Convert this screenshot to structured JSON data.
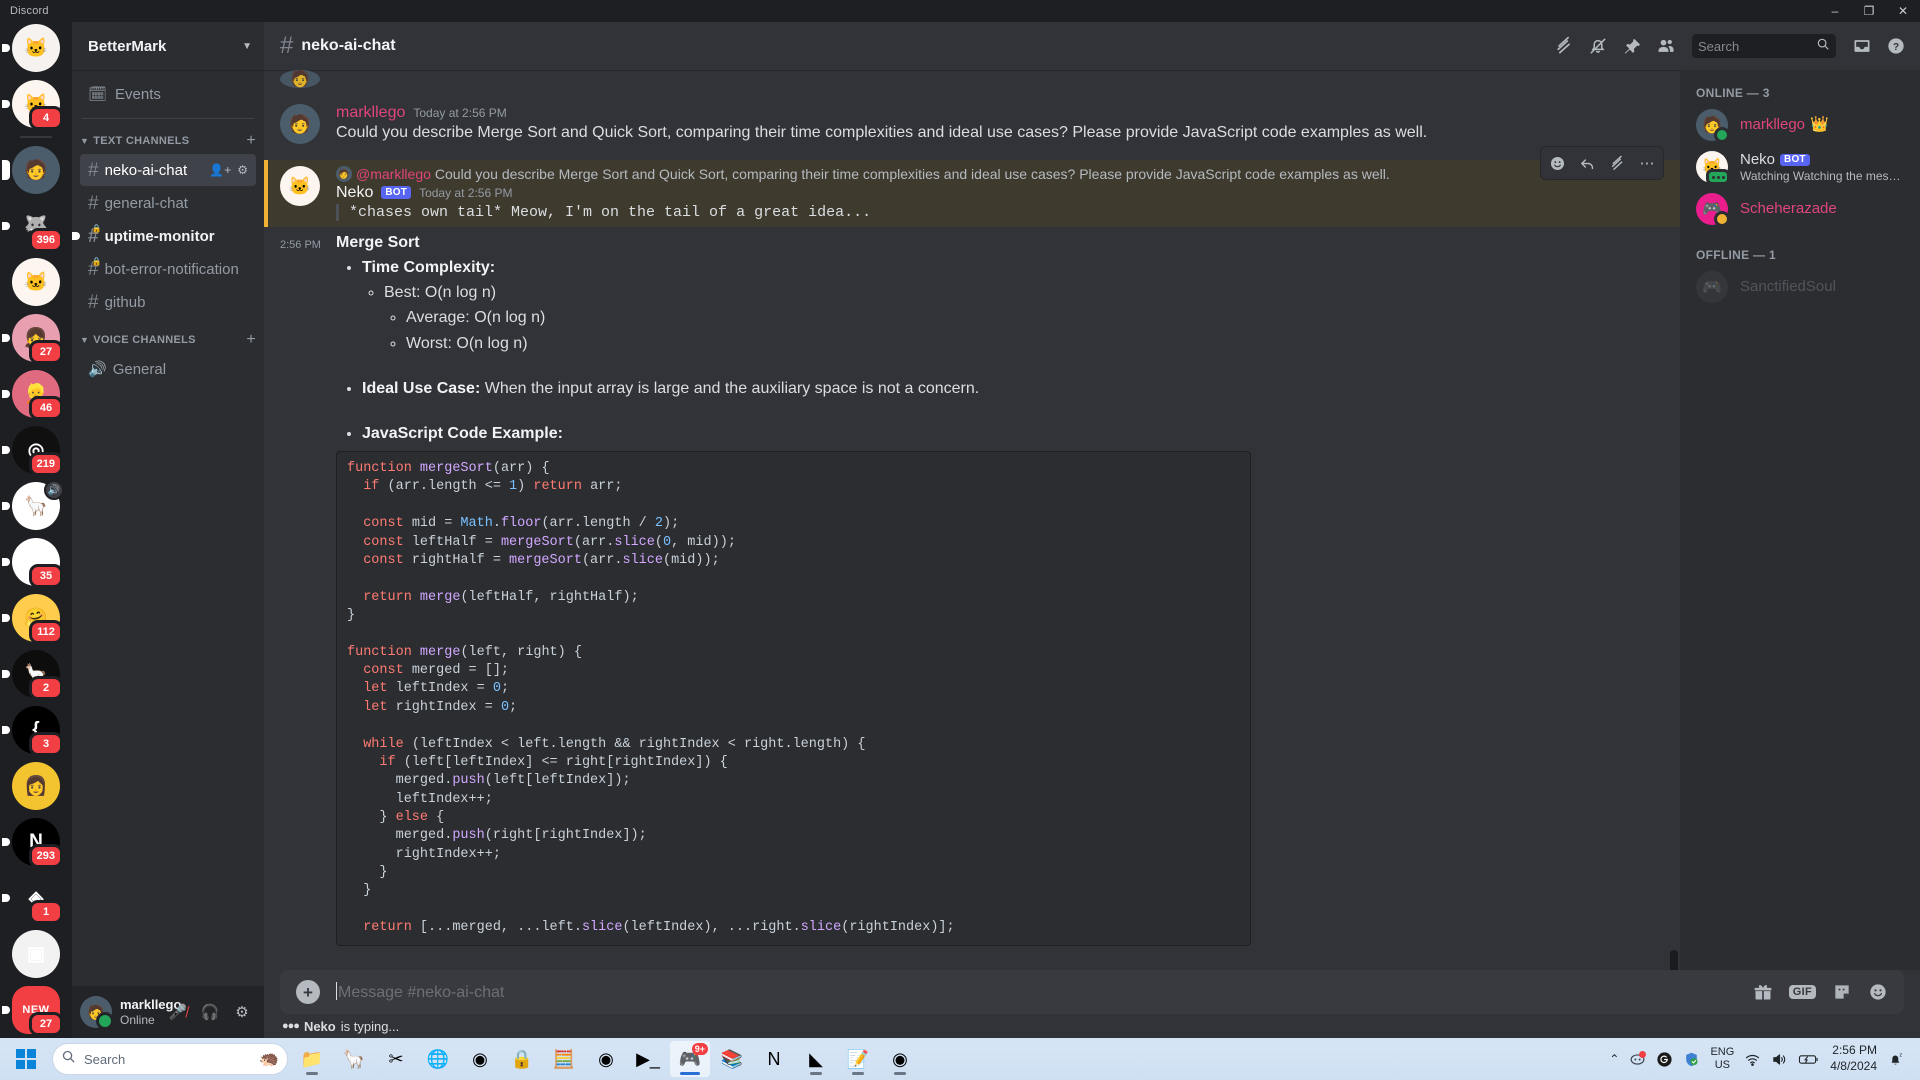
{
  "window": {
    "title": "Discord",
    "minimize": "–",
    "maximize": "❐",
    "close": "✕"
  },
  "rail": {
    "servers": [
      {
        "name": "neko-server-top",
        "badge": "",
        "glyph": "🐱",
        "bg": "#f6f2ef",
        "pill": "dot"
      },
      {
        "name": "meow-server",
        "badge": "4",
        "glyph": "🐱",
        "bg": "#fdf6f0",
        "pill": "dot"
      },
      {
        "name": "bettermark-server",
        "badge": "",
        "glyph": "🧑",
        "bg": "#4b5d6b",
        "pill": "tall"
      },
      {
        "name": "inu-server",
        "badge": "396",
        "glyph": "🐺",
        "bg": "#1e1f22",
        "pill": "dot"
      },
      {
        "name": "meow-server-2",
        "badge": "",
        "glyph": "🐱",
        "bg": "#fdf6f0",
        "pill": ""
      },
      {
        "name": "anime-server-1",
        "badge": "27",
        "glyph": "👧",
        "bg": "#e8a0b0",
        "pill": "dot"
      },
      {
        "name": "anime-server-2",
        "badge": "46",
        "glyph": "👱",
        "bg": "#e06a80",
        "pill": "dot"
      },
      {
        "name": "openai-server",
        "badge": "219",
        "glyph": "◎",
        "bg": "#101010",
        "pill": "dot"
      },
      {
        "name": "llama-server",
        "badge": "",
        "glyph": "🦙",
        "bg": "#ffffff",
        "pill": "dot",
        "voice": "🔊"
      },
      {
        "name": "drive-server",
        "badge": "35",
        "glyph": "◆",
        "bg": "#ffffff",
        "pill": "dot"
      },
      {
        "name": "emoji-server",
        "badge": "112",
        "glyph": "🤗",
        "bg": "#ffcc4d",
        "pill": "dot"
      },
      {
        "name": "ollama-server",
        "badge": "2",
        "glyph": "🦙",
        "bg": "#0d0d0d",
        "pill": "dot"
      },
      {
        "name": "brace-server",
        "badge": "3",
        "glyph": "{",
        "bg": "#000000",
        "pill": "dot"
      },
      {
        "name": "kafka-services-server",
        "badge": "",
        "glyph": "👩",
        "bg": "#f4c430",
        "pill": ""
      },
      {
        "name": "notion-dev-server",
        "badge": "293",
        "glyph": "N",
        "bg": "#000000",
        "pill": "dot"
      },
      {
        "name": "orange-diamond-server",
        "badge": "1",
        "glyph": "◈",
        "bg": "#1e1f22",
        "pill": "dot"
      },
      {
        "name": "screenshot-server",
        "badge": "",
        "glyph": "▣",
        "bg": "#f2f2f2",
        "pill": ""
      },
      {
        "name": "new-server",
        "badge": "27",
        "glyph": "",
        "bg": "#f23f43",
        "pill": "dot",
        "banner": "NEW"
      }
    ]
  },
  "sidebar": {
    "guild_name": "BetterMark",
    "events_label": "Events",
    "categories": [
      {
        "name": "TEXT CHANNELS",
        "channels": [
          {
            "name": "neko-ai-chat",
            "state": "active",
            "private": false,
            "actions": [
              "invite",
              "settings"
            ]
          },
          {
            "name": "general-chat",
            "state": "normal",
            "private": false
          },
          {
            "name": "uptime-monitor",
            "state": "unread",
            "private": true
          },
          {
            "name": "bot-error-notification",
            "state": "normal",
            "private": true
          },
          {
            "name": "github",
            "state": "normal",
            "private": false
          }
        ]
      },
      {
        "name": "VOICE CHANNELS",
        "channels": [
          {
            "name": "General",
            "state": "normal",
            "voice": true
          }
        ]
      }
    ],
    "user": {
      "name": "markllego",
      "status": "Online",
      "mic_label": "mute",
      "headset_label": "deafen",
      "settings_label": "settings"
    }
  },
  "header": {
    "channel": "neko-ai-chat",
    "search_placeholder": "Search",
    "icons": [
      "threads-icon",
      "notifications-muted-icon",
      "pinned-messages-icon",
      "members-icon",
      "inbox-icon",
      "help-icon"
    ]
  },
  "messages": {
    "user_message": {
      "author": "markllego",
      "timestamp": "Today at 2:56 PM",
      "text": "Could you describe Merge Sort and Quick Sort, comparing their time complexities and ideal use cases? Please provide JavaScript code examples as well."
    },
    "bot_message": {
      "reply_mention": "@markllego",
      "reply_preview": "Could you describe Merge Sort and Quick Sort, comparing their time complexities and ideal use cases? Please provide JavaScript code examples as well.",
      "author": "Neko",
      "bot_tag": "BOT",
      "timestamp": "Today at 2:56 PM",
      "thinking_line": "*chases own tail* Meow, I'm on the tail of a great idea...",
      "hover_actions": [
        "add-reaction",
        "reply",
        "create-thread",
        "more"
      ]
    },
    "answer": {
      "timestamp": "2:56 PM",
      "heading": "Merge Sort",
      "time_complexity_label": "Time Complexity:",
      "complexities": [
        "Best: O(n log n)",
        "Average: O(n log n)",
        "Worst: O(n log n)"
      ],
      "ideal_label": "Ideal Use Case:",
      "ideal_text": " When the input array is large and the auxiliary space is not a concern.",
      "code_label": "JavaScript Code Example:"
    }
  },
  "composer": {
    "placeholder": "Message #neko-ai-chat",
    "typing_indicator_name": "Neko",
    "typing_indicator_rest": " is typing...",
    "icons": [
      "gift-icon",
      "gif-icon",
      "sticker-icon",
      "emoji-icon"
    ],
    "gif_label": "GIF"
  },
  "members": {
    "online_label": "ONLINE — 3",
    "offline_label": "OFFLINE — 1",
    "online": [
      {
        "name": "markllego",
        "color": "pink",
        "crown": "👑",
        "status": "online",
        "activity": ""
      },
      {
        "name": "Neko",
        "color": "white",
        "bot_tag": "BOT",
        "status": "bot",
        "activity": "Watching Watching the mesm…"
      },
      {
        "name": "Scheherazade",
        "color": "pink",
        "status": "idle",
        "activity": ""
      }
    ],
    "offline": [
      {
        "name": "SanctifiedSoul",
        "color": "off",
        "status": "offline",
        "activity": ""
      }
    ]
  },
  "taskbar": {
    "search_placeholder": "Search",
    "apps": [
      {
        "name": "file-explorer-icon",
        "glyph": "📁",
        "open": true
      },
      {
        "name": "llama-icon",
        "glyph": "🦙",
        "open": false
      },
      {
        "name": "snipping-tool-icon",
        "glyph": "✂",
        "open": false
      },
      {
        "name": "green-globe-icon",
        "glyph": "🌐",
        "open": false
      },
      {
        "name": "github-icon",
        "glyph": "◉",
        "open": false
      },
      {
        "name": "lock-upload-icon",
        "glyph": "🔒",
        "open": false
      },
      {
        "name": "calculator-icon",
        "glyph": "🧮",
        "open": false
      },
      {
        "name": "webcam-icon",
        "glyph": "◉",
        "open": false
      },
      {
        "name": "terminal-icon",
        "glyph": "▶_",
        "open": false
      },
      {
        "name": "discord-icon",
        "glyph": "🎮",
        "open": true,
        "active": true,
        "badge": "9+"
      },
      {
        "name": "notes-app-icon",
        "glyph": "📚",
        "open": false
      },
      {
        "name": "notion-icon",
        "glyph": "N",
        "open": false
      },
      {
        "name": "vscode-icon",
        "glyph": "◣",
        "open": true
      },
      {
        "name": "notepad-icon",
        "glyph": "📝",
        "open": true
      },
      {
        "name": "chrome-icon",
        "glyph": "◉",
        "open": true
      }
    ],
    "tray": {
      "chevron": "⌃",
      "discord_tray_icon": "discord-tray-icon",
      "logitech_icon": "logitech-tray-icon",
      "defender_icon": "windows-defender-icon",
      "language": "ENG",
      "region": "US",
      "wifi": "wifi-icon",
      "volume": "volume-icon",
      "battery": "battery-charging-icon",
      "time": "2:56 PM",
      "date": "4/8/2024",
      "notification": "notification-bell-icon"
    }
  },
  "code": {
    "lines": [
      [
        {
          "t": "function ",
          "c": "kw"
        },
        {
          "t": "mergeSort",
          "c": "fn"
        },
        {
          "t": "(arr) {",
          "c": "pl"
        }
      ],
      [
        {
          "t": "  if ",
          "c": "kw"
        },
        {
          "t": "(arr.length <= ",
          "c": "pl"
        },
        {
          "t": "1",
          "c": "num"
        },
        {
          "t": ") ",
          "c": "pl"
        },
        {
          "t": "return ",
          "c": "kw"
        },
        {
          "t": "arr;",
          "c": "pl"
        }
      ],
      [
        {
          "t": "",
          "c": "pl"
        }
      ],
      [
        {
          "t": "  const ",
          "c": "kw"
        },
        {
          "t": "mid = ",
          "c": "pl"
        },
        {
          "t": "Math",
          "c": "cls"
        },
        {
          "t": ".",
          "c": "pl"
        },
        {
          "t": "floor",
          "c": "fn"
        },
        {
          "t": "(arr.length / ",
          "c": "pl"
        },
        {
          "t": "2",
          "c": "num"
        },
        {
          "t": ");",
          "c": "pl"
        }
      ],
      [
        {
          "t": "  const ",
          "c": "kw"
        },
        {
          "t": "leftHalf = ",
          "c": "pl"
        },
        {
          "t": "mergeSort",
          "c": "fn"
        },
        {
          "t": "(arr.",
          "c": "pl"
        },
        {
          "t": "slice",
          "c": "fn"
        },
        {
          "t": "(",
          "c": "pl"
        },
        {
          "t": "0",
          "c": "num"
        },
        {
          "t": ", mid));",
          "c": "pl"
        }
      ],
      [
        {
          "t": "  const ",
          "c": "kw"
        },
        {
          "t": "rightHalf = ",
          "c": "pl"
        },
        {
          "t": "mergeSort",
          "c": "fn"
        },
        {
          "t": "(arr.",
          "c": "pl"
        },
        {
          "t": "slice",
          "c": "fn"
        },
        {
          "t": "(mid));",
          "c": "pl"
        }
      ],
      [
        {
          "t": "",
          "c": "pl"
        }
      ],
      [
        {
          "t": "  return ",
          "c": "kw"
        },
        {
          "t": "merge",
          "c": "fn"
        },
        {
          "t": "(leftHalf, rightHalf);",
          "c": "pl"
        }
      ],
      [
        {
          "t": "}",
          "c": "pl"
        }
      ],
      [
        {
          "t": "",
          "c": "pl"
        }
      ],
      [
        {
          "t": "function ",
          "c": "kw"
        },
        {
          "t": "merge",
          "c": "fn"
        },
        {
          "t": "(left, right) {",
          "c": "pl"
        }
      ],
      [
        {
          "t": "  const ",
          "c": "kw"
        },
        {
          "t": "merged = [];",
          "c": "pl"
        }
      ],
      [
        {
          "t": "  let ",
          "c": "kw"
        },
        {
          "t": "leftIndex = ",
          "c": "pl"
        },
        {
          "t": "0",
          "c": "num"
        },
        {
          "t": ";",
          "c": "pl"
        }
      ],
      [
        {
          "t": "  let ",
          "c": "kw"
        },
        {
          "t": "rightIndex = ",
          "c": "pl"
        },
        {
          "t": "0",
          "c": "num"
        },
        {
          "t": ";",
          "c": "pl"
        }
      ],
      [
        {
          "t": "",
          "c": "pl"
        }
      ],
      [
        {
          "t": "  while ",
          "c": "kw"
        },
        {
          "t": "(leftIndex < left.length && rightIndex < right.length) {",
          "c": "pl"
        }
      ],
      [
        {
          "t": "    if ",
          "c": "kw"
        },
        {
          "t": "(left[leftIndex] <= right[rightIndex]) {",
          "c": "pl"
        }
      ],
      [
        {
          "t": "      merged.",
          "c": "pl"
        },
        {
          "t": "push",
          "c": "fn"
        },
        {
          "t": "(left[leftIndex]);",
          "c": "pl"
        }
      ],
      [
        {
          "t": "      leftIndex++;",
          "c": "pl"
        }
      ],
      [
        {
          "t": "    } ",
          "c": "pl"
        },
        {
          "t": "else",
          "c": "kw"
        },
        {
          "t": " {",
          "c": "pl"
        }
      ],
      [
        {
          "t": "      merged.",
          "c": "pl"
        },
        {
          "t": "push",
          "c": "fn"
        },
        {
          "t": "(right[rightIndex]);",
          "c": "pl"
        }
      ],
      [
        {
          "t": "      rightIndex++;",
          "c": "pl"
        }
      ],
      [
        {
          "t": "    }",
          "c": "pl"
        }
      ],
      [
        {
          "t": "  }",
          "c": "pl"
        }
      ],
      [
        {
          "t": "",
          "c": "pl"
        }
      ],
      [
        {
          "t": "  return ",
          "c": "kw"
        },
        {
          "t": "[...merged, ...left.",
          "c": "pl"
        },
        {
          "t": "slice",
          "c": "fn"
        },
        {
          "t": "(leftIndex), ...right.",
          "c": "pl"
        },
        {
          "t": "slice",
          "c": "fn"
        },
        {
          "t": "(rightIndex)];",
          "c": "pl"
        }
      ]
    ]
  },
  "colors": {
    "brand": "#5865f2",
    "online": "#23a55a",
    "idle": "#f0b232",
    "danger": "#f23f43",
    "mention_highlight": "#3f3a2e",
    "username_pink": "#e0457b"
  }
}
